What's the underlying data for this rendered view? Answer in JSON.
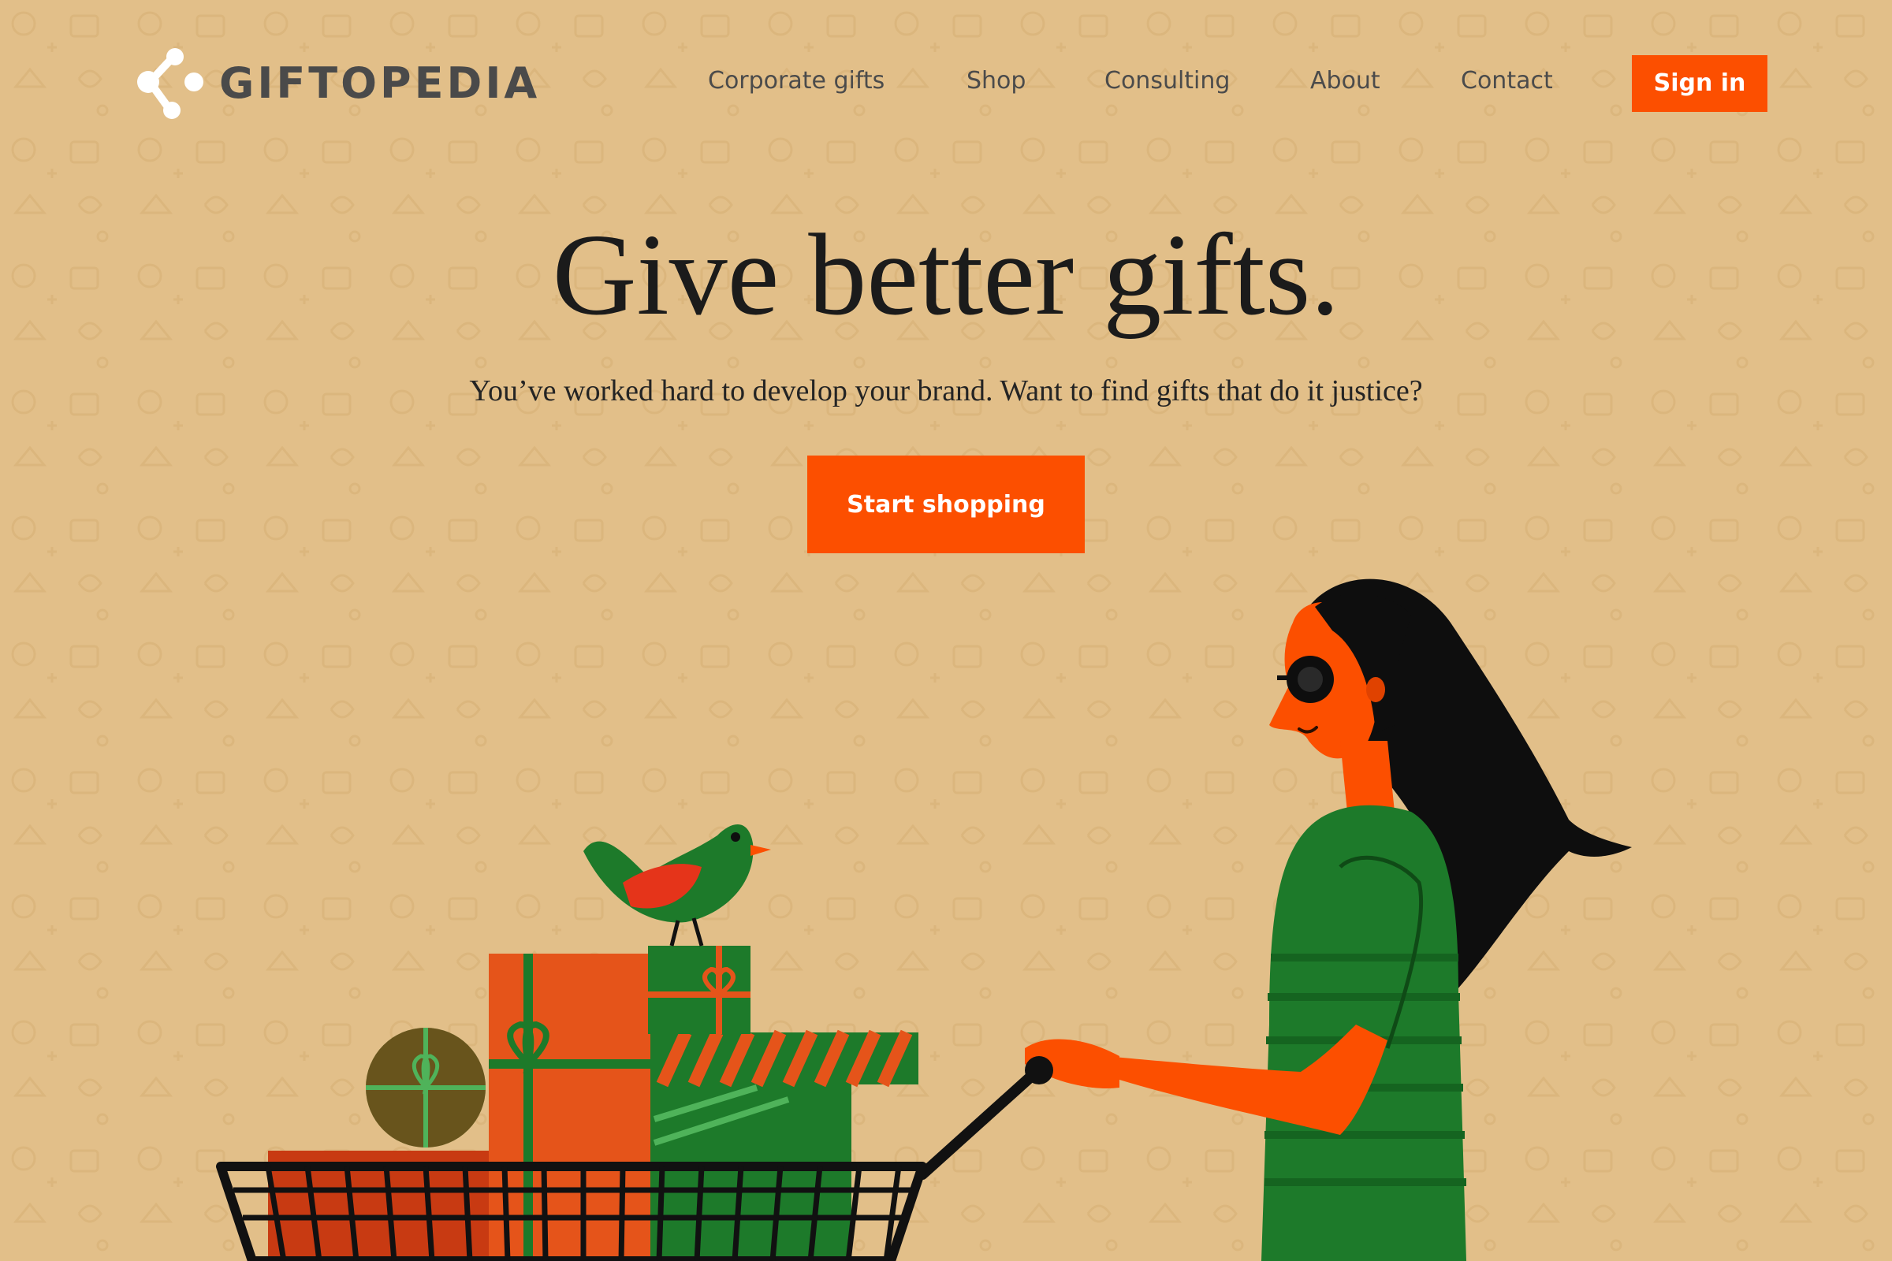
{
  "brand": {
    "name": "GIFTOPEDIA",
    "logo_icon": "network-dots-icon"
  },
  "nav": {
    "items": [
      {
        "label": "Corporate gifts"
      },
      {
        "label": "Shop"
      },
      {
        "label": "Consulting"
      },
      {
        "label": "About"
      },
      {
        "label": "Contact"
      }
    ],
    "sign_in_label": "Sign in"
  },
  "hero": {
    "title": "Give better gifts.",
    "subtitle": "You’ve worked hard to develop your brand. Want to find gifts that do it justice?",
    "cta_label": "Start shopping"
  },
  "colors": {
    "background": "#e2bf89",
    "accent": "#fc4f00",
    "green": "#1d7a2a",
    "text_dark": "#1b1b1b"
  }
}
